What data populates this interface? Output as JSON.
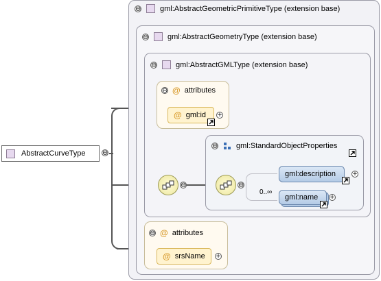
{
  "root": {
    "label": "AbstractCurveType"
  },
  "ext1": {
    "label": "gml:AbstractGeometricPrimitiveType (extension base)"
  },
  "ext2": {
    "label": "gml:AbstractGeometryType (extension base)"
  },
  "ext3": {
    "label": "gml:AbstractGMLType (extension base)"
  },
  "attrs1": {
    "title": "attributes",
    "items": [
      "gml:id"
    ]
  },
  "attrs2": {
    "title": "attributes",
    "items": [
      "srsName"
    ]
  },
  "group": {
    "label": "gml:StandardObjectProperties",
    "elements": [
      "gml:description",
      "gml:name"
    ],
    "cardinality": "0..∞"
  },
  "symbols": {
    "at": "@",
    "collapse": "⊖",
    "expand": "+"
  },
  "icons": [
    "collapse-icon",
    "expand-icon",
    "type-icon",
    "attribute-icon",
    "link-arrow-icon",
    "sequence-icon",
    "group-icon"
  ]
}
